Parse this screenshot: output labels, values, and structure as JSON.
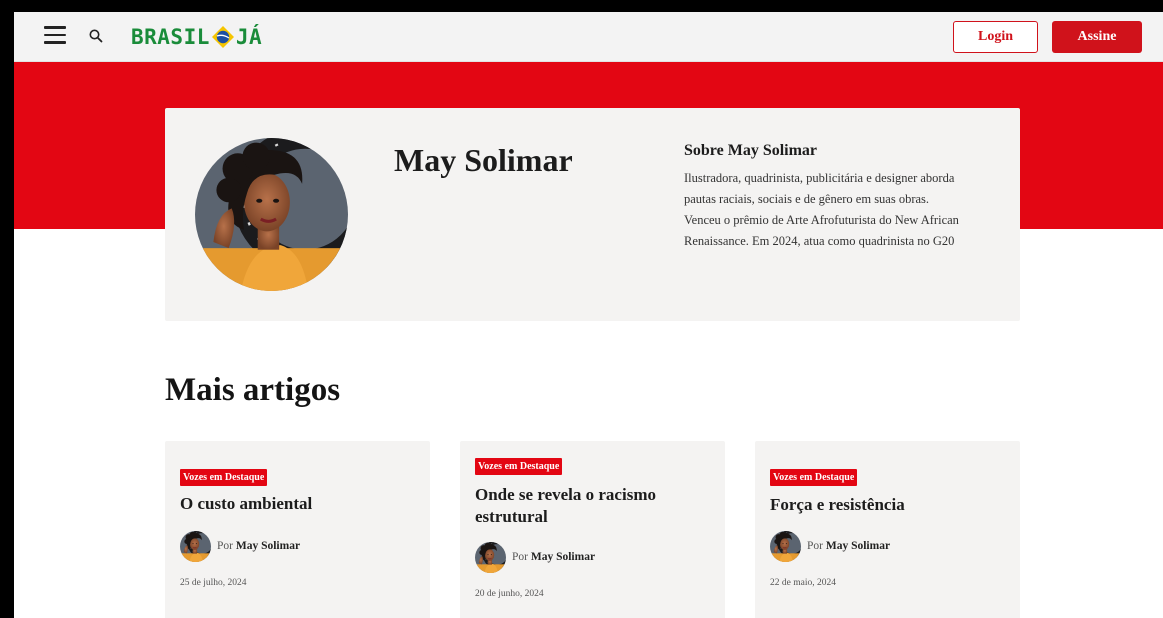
{
  "header": {
    "logo": {
      "part1": "BRASIL",
      "part2": "JÁ"
    },
    "login_label": "Login",
    "subscribe_label": "Assine"
  },
  "profile": {
    "name": "May Solimar",
    "about_title": "Sobre May Solimar",
    "about_lines": [
      "Ilustradora, quadrinista, publicitária e designer aborda",
      "pautas raciais, sociais e de gênero em suas obras.",
      "Venceu o prêmio de Arte Afrofuturista do New African",
      "Renaissance. Em 2024, atua como quadrinista no G20"
    ]
  },
  "section_title": "Mais artigos",
  "articles": [
    {
      "tag": "Vozes em Destaque",
      "title": "O custo ambiental",
      "by_prefix": "Por",
      "author": "May Solimar",
      "date": "25 de julho, 2024"
    },
    {
      "tag": "Vozes em Destaque",
      "title": "Onde se revela o racismo estrutural",
      "by_prefix": "Por",
      "author": "May Solimar",
      "date": "20 de junho, 2024"
    },
    {
      "tag": "Vozes em Destaque",
      "title": "Força e resistência",
      "by_prefix": "Por",
      "author": "May Solimar",
      "date": "22 de maio, 2024"
    }
  ],
  "colors": {
    "brand_red": "#e30613",
    "logo_green": "#1a8c3a",
    "card_bg": "#f4f3f2"
  },
  "icons": [
    "menu-icon",
    "search-icon"
  ]
}
